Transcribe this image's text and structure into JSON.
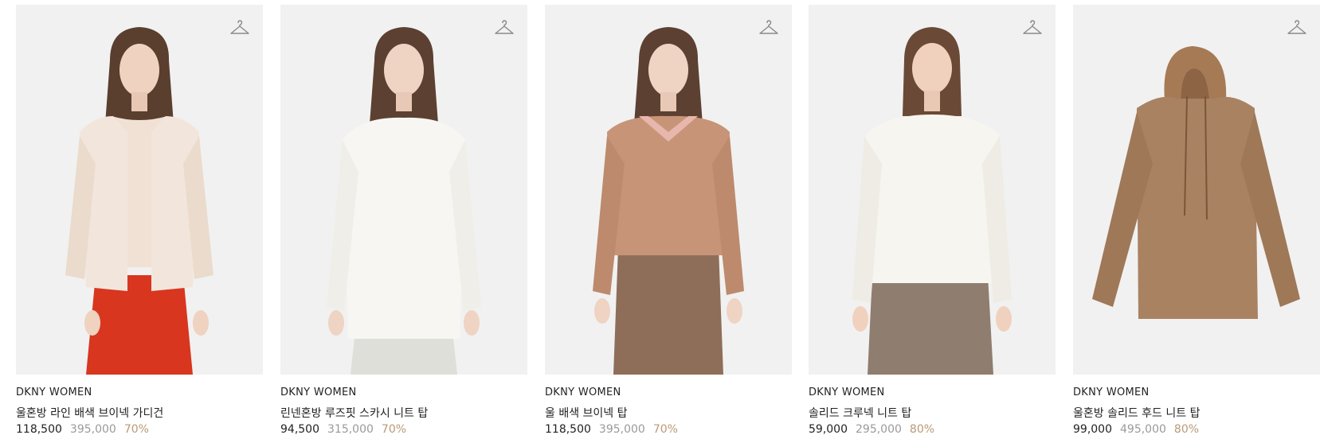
{
  "products": [
    {
      "brand": "DKNY WOMEN",
      "name": "울혼방 라인 배색 브이넥 가디건",
      "sale_price": "118,500",
      "original_price": "395,000",
      "discount": "70%",
      "icon": "hanger-icon"
    },
    {
      "brand": "DKNY WOMEN",
      "name": "린넨혼방 루즈핏 스카시 니트 탑",
      "sale_price": "94,500",
      "original_price": "315,000",
      "discount": "70%",
      "icon": "hanger-icon"
    },
    {
      "brand": "DKNY WOMEN",
      "name": "울 배색 브이넥 탑",
      "sale_price": "118,500",
      "original_price": "395,000",
      "discount": "70%",
      "icon": "hanger-icon"
    },
    {
      "brand": "DKNY WOMEN",
      "name": "솔리드 크루넥 니트 탑",
      "sale_price": "59,000",
      "original_price": "295,000",
      "discount": "80%",
      "icon": "hanger-icon"
    },
    {
      "brand": "DKNY WOMEN",
      "name": "울혼방 솔리드 후드 니트 탑",
      "sale_price": "99,000",
      "original_price": "495,000",
      "discount": "80%",
      "icon": "hanger-icon"
    }
  ],
  "colors": {
    "image_bg": "#f1f1f1",
    "discount": "#b89a76",
    "original_price": "#9a9a9a"
  }
}
